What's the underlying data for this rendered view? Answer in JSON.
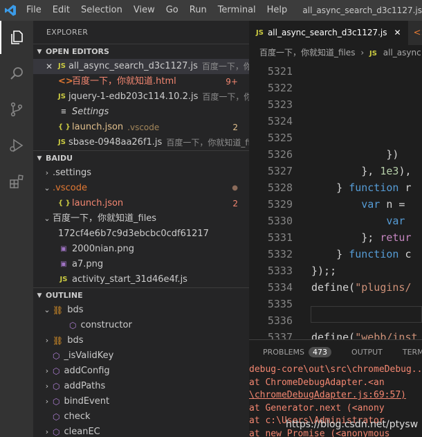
{
  "titlebar": {
    "menus": [
      "File",
      "Edit",
      "Selection",
      "View",
      "Go",
      "Run",
      "Terminal",
      "Help"
    ],
    "window_title": "all_async_search_d3c1127.js"
  },
  "activity": [
    "explorer-icon",
    "search-icon",
    "source-control-icon",
    "run-debug-icon",
    "extensions-icon"
  ],
  "sidebar": {
    "title": "EXPLORER",
    "open_editors": {
      "header": "OPEN EDITORS",
      "items": [
        {
          "icon": "JS",
          "name": "all_async_search_d3c1127.js",
          "desc": "百度一下，你就...",
          "badge": "",
          "close": "✕"
        },
        {
          "icon": "<>",
          "name": "百度一下，你就知道.html",
          "desc": "",
          "badge": "9+"
        },
        {
          "icon": "JS",
          "name": "jquery-1-edb203c114.10.2.js",
          "desc": "百度一下，你...",
          "badge": ""
        },
        {
          "icon": "≡",
          "name": "Settings",
          "desc": "",
          "badge": ""
        },
        {
          "icon": "{ }",
          "name": "launch.json",
          "desc": ".vscode",
          "badge": "2"
        },
        {
          "icon": "JS",
          "name": "sbase-0948aa26f1.js",
          "desc": "百度一下，你就知道_files",
          "badge": ""
        }
      ]
    },
    "folder": {
      "header": "BAIDU",
      "items": [
        {
          "twist": "›",
          "icon": "",
          "name": ".settings",
          "badge": ""
        },
        {
          "twist": "⌄",
          "icon": "",
          "name": ".vscode",
          "badge": "●"
        },
        {
          "twist": "",
          "icon": "{ }",
          "name": "launch.json",
          "badge": "2"
        },
        {
          "twist": "⌄",
          "icon": "",
          "name": "百度一下，你就知道_files",
          "badge": ""
        },
        {
          "twist": "",
          "icon": "",
          "name": "172cf4e6b7c9d3ebcbc0cdf61217",
          "badge": ""
        },
        {
          "twist": "",
          "icon": "▣",
          "name": "2000nian.png",
          "badge": ""
        },
        {
          "twist": "",
          "icon": "▣",
          "name": "a7.png",
          "badge": ""
        },
        {
          "twist": "",
          "icon": "JS",
          "name": "activity_start_31d46e4f.js",
          "badge": ""
        }
      ]
    },
    "outline": {
      "header": "OUTLINE",
      "items": [
        {
          "twist": "⌄",
          "icon": "class",
          "name": "bds"
        },
        {
          "twist": "",
          "icon": "cube",
          "name": "constructor"
        },
        {
          "twist": "›",
          "icon": "class",
          "name": "bds"
        },
        {
          "twist": "",
          "icon": "cube",
          "name": "_isValidKey"
        },
        {
          "twist": "›",
          "icon": "cube",
          "name": "addConfig"
        },
        {
          "twist": "›",
          "icon": "cube",
          "name": "addPaths"
        },
        {
          "twist": "›",
          "icon": "cube",
          "name": "bindEvent"
        },
        {
          "twist": "",
          "icon": "cube",
          "name": "check"
        },
        {
          "twist": "›",
          "icon": "cube",
          "name": "cleanEC"
        }
      ]
    }
  },
  "editor": {
    "tabs": [
      {
        "icon": "JS",
        "label": "all_async_search_d3c1127.js",
        "close": "✕"
      },
      {
        "icon": "<>",
        "label": ""
      }
    ],
    "breadcrumb": [
      "百度一下，你就知道_files",
      "›",
      "JS",
      "all_async"
    ],
    "lines": [
      {
        "n": "5321",
        "segs": []
      },
      {
        "n": "5322",
        "segs": []
      },
      {
        "n": "5323",
        "segs": []
      },
      {
        "n": "5324",
        "segs": []
      },
      {
        "n": "5325",
        "segs": []
      },
      {
        "n": "5326",
        "segs": [
          {
            "t": "            })",
            "c": ""
          }
        ]
      },
      {
        "n": "5327",
        "segs": [
          {
            "t": "        }, ",
            "c": ""
          },
          {
            "t": "1e3",
            "c": "num"
          },
          {
            "t": "),",
            "c": ""
          }
        ]
      },
      {
        "n": "5328",
        "segs": [
          {
            "t": "    } ",
            "c": ""
          },
          {
            "t": "function",
            "c": "kw"
          },
          {
            "t": " r",
            "c": ""
          }
        ]
      },
      {
        "n": "5329",
        "segs": [
          {
            "t": "        ",
            "c": ""
          },
          {
            "t": "var",
            "c": "kw"
          },
          {
            "t": " n = ",
            "c": ""
          }
        ]
      },
      {
        "n": "5330",
        "segs": [
          {
            "t": "            ",
            "c": ""
          },
          {
            "t": "var",
            "c": "kw"
          },
          {
            "t": " ",
            "c": ""
          }
        ]
      },
      {
        "n": "5331",
        "segs": [
          {
            "t": "        }; ",
            "c": ""
          },
          {
            "t": "retur",
            "c": "kwc"
          }
        ]
      },
      {
        "n": "5332",
        "segs": [
          {
            "t": "    } ",
            "c": ""
          },
          {
            "t": "function",
            "c": "kw"
          },
          {
            "t": " c",
            "c": ""
          }
        ]
      },
      {
        "n": "5333",
        "segs": [
          {
            "t": "});;",
            "c": ""
          }
        ]
      },
      {
        "n": "5334",
        "segs": [
          {
            "t": "define(",
            "c": ""
          },
          {
            "t": "\"plugins/",
            "c": "str"
          }
        ]
      },
      {
        "n": "5335",
        "segs": []
      },
      {
        "n": "5336",
        "segs": []
      },
      {
        "n": "5337",
        "segs": [
          {
            "t": "define(",
            "c": ""
          },
          {
            "t": "\"webb/inst",
            "c": "str"
          }
        ]
      }
    ]
  },
  "panel": {
    "tabs": [
      {
        "label": "PROBLEMS",
        "count": "473"
      },
      {
        "label": "OUTPUT"
      },
      {
        "label": "TERMINAL"
      }
    ],
    "lines": [
      "      debug-core\\out\\src\\chromeDebug...",
      "    at ChromeDebugAdapter.<an",
      "\\chromeDebugAdapter.js:69:57)",
      "    at Generator.next (<anony",
      "    at c:\\Users\\Administrator",
      "    at new Promise (<anonymous"
    ]
  },
  "watermark": "https://blog.csdn.net/ptysw"
}
